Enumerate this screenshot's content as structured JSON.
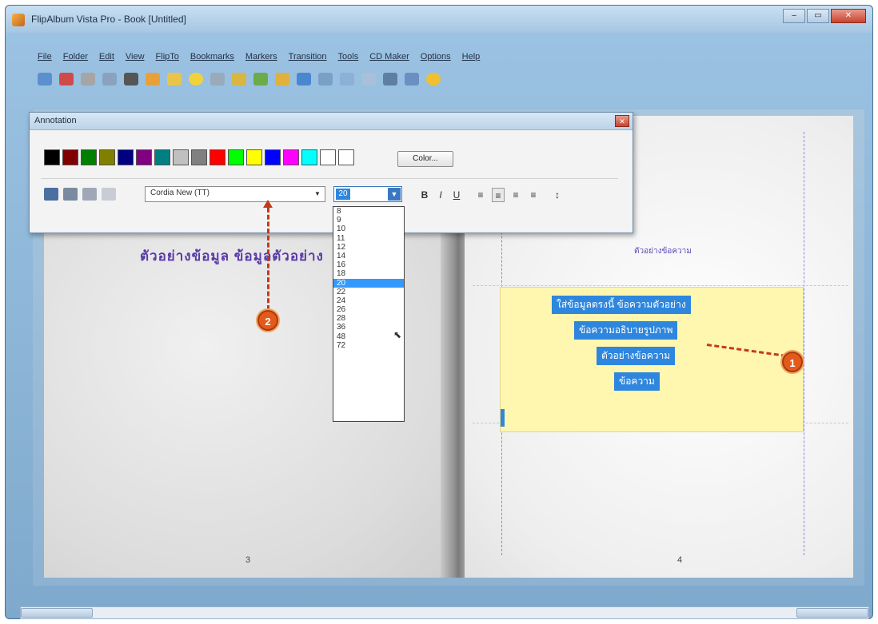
{
  "window": {
    "title": "FlipAlbum Vista Pro - Book [Untitled]",
    "controls": [
      "–",
      "▭",
      "✕"
    ]
  },
  "menubar": {
    "items": [
      "File",
      "Folder",
      "Edit",
      "View",
      "FlipTo",
      "Bookmarks",
      "Markers",
      "Transition",
      "Tools",
      "CD Maker",
      "Options",
      "Help"
    ]
  },
  "toolbar": {
    "icons": [
      "open-icon",
      "save-icon",
      "print-icon",
      "cut-icon",
      "copy-icon",
      "paste-icon",
      "folder-icon",
      "music-icon",
      "undo-icon",
      "slideshow-icon",
      "bookmark-icon",
      "image-icon",
      "check-icon",
      "layout-icon",
      "frame-icon",
      "page-icon",
      "export-icon",
      "help-icon",
      "cd-icon"
    ]
  },
  "dialog": {
    "title": "Annotation",
    "close": "✕",
    "swatches": [
      "#000000",
      "#800000",
      "#008000",
      "#808000",
      "#000080",
      "#800080",
      "#008080",
      "#c0c0c0",
      "#808080",
      "#ff0000",
      "#00ff00",
      "#ffff00",
      "#0000ff",
      "#ff00ff",
      "#00ffff",
      "#ffffff",
      "#ffffff"
    ],
    "color_button": "Color...",
    "font_value": "Cordia New (TT)",
    "size_value": "20",
    "format_buttons": [
      "B",
      "I",
      "U"
    ]
  },
  "size_dropdown": {
    "options": [
      "8",
      "9",
      "10",
      "11",
      "12",
      "14",
      "16",
      "18",
      "20",
      "22",
      "24",
      "26",
      "28",
      "36",
      "48",
      "72"
    ],
    "selected": "20"
  },
  "pages": {
    "left_heading": "ตัวอย่างข้อมูล ข้อมูลตัวอย่าง",
    "right_heading": "ตัวอย่างข้อความ",
    "left_number": "3",
    "right_number": "4",
    "textbox_lines": [
      "ใส่ข้อมูลตรงนี้ ข้อความตัวอย่าง",
      "ข้อความอธิบายรูปภาพ",
      "ตัวอย่างข้อความ",
      "ข้อความ"
    ]
  },
  "markers": {
    "a": "2",
    "b": "1"
  }
}
